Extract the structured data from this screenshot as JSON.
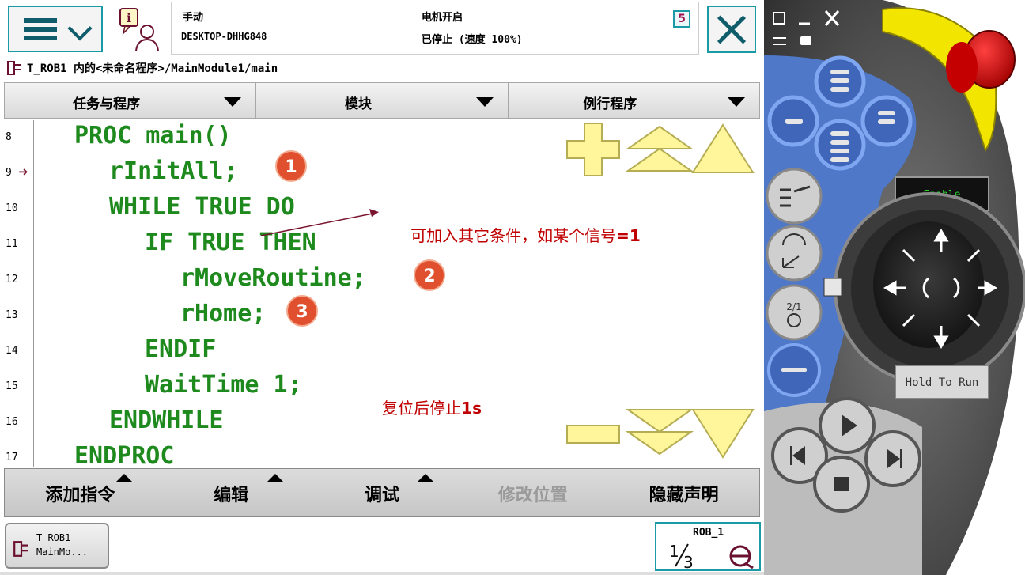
{
  "header": {
    "mode": "手动",
    "host": "DESKTOP-DHHG848",
    "motor_state": "电机开启",
    "run_state": "已停止 (速度 100%)",
    "status_icon": "5"
  },
  "breadcrumb": {
    "text": "T_ROB1 内的<未命名程序>/MainModule1/main"
  },
  "tabs": [
    {
      "label": "任务与程序"
    },
    {
      "label": "模块"
    },
    {
      "label": "例行程序"
    }
  ],
  "code": {
    "lines": [
      {
        "num": "8",
        "text": "PROC main()"
      },
      {
        "num": "9",
        "text": "rInitAll;"
      },
      {
        "num": "10",
        "text": "WHILE TRUE DO"
      },
      {
        "num": "11",
        "text": "IF TRUE THEN"
      },
      {
        "num": "12",
        "text": "rMoveRoutine;"
      },
      {
        "num": "13",
        "text": "rHome;"
      },
      {
        "num": "14",
        "text": "ENDIF"
      },
      {
        "num": "15",
        "text": "WaitTime 1;"
      },
      {
        "num": "16",
        "text": "ENDWHILE"
      },
      {
        "num": "17",
        "text": "ENDPROC"
      }
    ],
    "program_pointer_line": "9"
  },
  "annotations": {
    "badge1": "1",
    "badge2": "2",
    "badge3": "3",
    "note_condition": "可加入其它条件，如某个信号",
    "note_condition_value": "=1",
    "note_wait": "复位后停止",
    "note_wait_value": "1s"
  },
  "bottom_menu": [
    {
      "label": "添加指令",
      "has_arrow": true,
      "enabled": true
    },
    {
      "label": "编辑",
      "has_arrow": true,
      "enabled": true
    },
    {
      "label": "调试",
      "has_arrow": true,
      "enabled": true
    },
    {
      "label": "修改位置",
      "has_arrow": false,
      "enabled": false
    },
    {
      "label": "隐藏声明",
      "has_arrow": false,
      "enabled": true
    }
  ],
  "taskbar": {
    "task_line1": "T_ROB1",
    "task_line2": "MainMo..."
  },
  "quickset": {
    "robot": "ROB_1",
    "fraction": "1/3"
  },
  "pendant": {
    "enable_label": "Enable",
    "hold_to_run_label": "Hold To Run"
  },
  "colors": {
    "teal": "#199aa5",
    "code_green": "#1e8a1e",
    "note_red": "#c00000",
    "badge_orange": "#e0502e",
    "nav_yellow": "#fff59a"
  }
}
